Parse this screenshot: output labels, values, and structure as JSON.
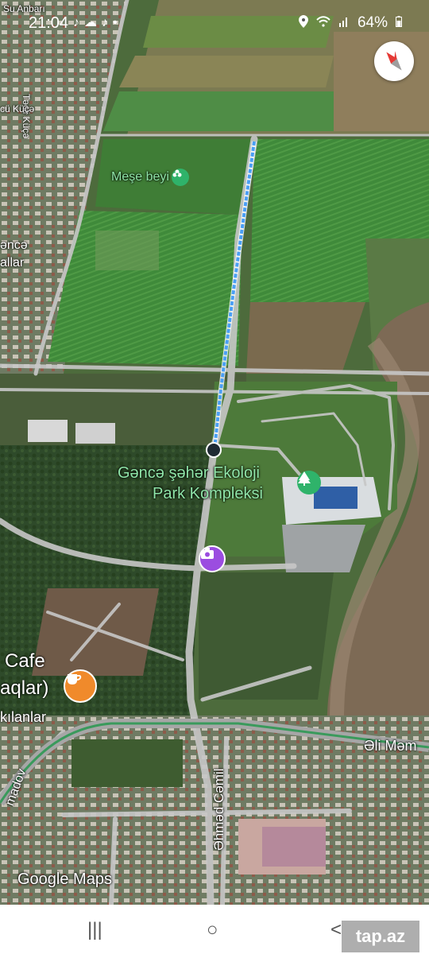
{
  "status_bar": {
    "time": "21:04",
    "battery": "64%",
    "left_icons": [
      "tiktok-icon",
      "cloud-icon",
      "tiktok-icon",
      "dot-icon"
    ],
    "right_icons": [
      "location-icon",
      "wifi-icon",
      "signal-icon",
      "battery-icon"
    ]
  },
  "map": {
    "labels": {
      "su_anbari": "Su Anbarı",
      "tacli_kuce": "Təcli Küçə",
      "cu_kuce": "cü Küçə",
      "mese_beyi": "Meşe beyi",
      "gence": "əncə",
      "allar": "allar",
      "park_line1": "Gəncə şəhər Ekoloji",
      "park_line2": "Park Kompleksi",
      "cafe": "Cafe",
      "aqlar": "aqlar)",
      "kilanlar": "kılanlar",
      "eli_mem": "Əli Məm",
      "ahmed_cemil": "Əhməd Cəmil",
      "madov": "madov"
    },
    "icons": [
      "flower-icon",
      "tree-icon",
      "camera-icon",
      "coffee-icon"
    ],
    "route_color": "#4a9ff5",
    "road_color": "#c7c7c7",
    "highway_color": "#3a9a5c"
  },
  "compass": {
    "icon": "compass-icon"
  },
  "branding": {
    "google_maps": "Google Maps"
  },
  "nav_bar": {
    "recents": "|||",
    "home": "○",
    "back": "<"
  },
  "watermark": "tap.az"
}
